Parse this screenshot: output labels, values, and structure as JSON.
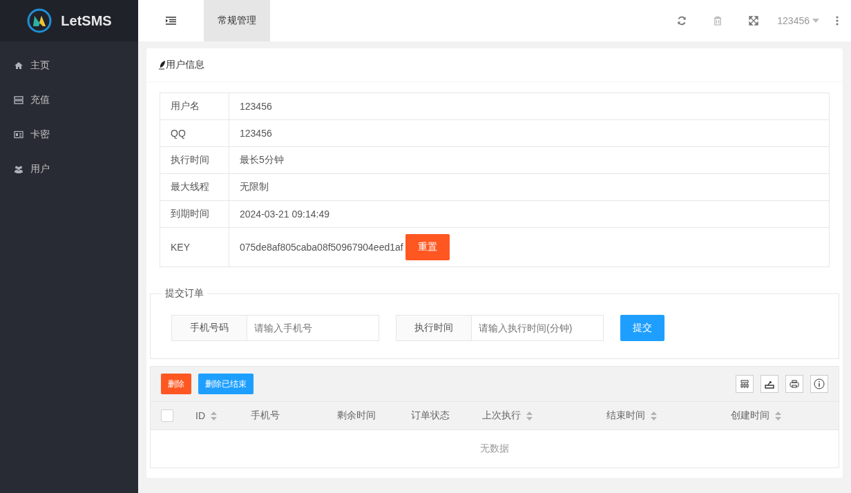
{
  "brand": {
    "name": "LetSMS"
  },
  "sidebar": {
    "items": [
      {
        "label": "主页",
        "kind": "home"
      },
      {
        "label": "充值",
        "kind": "server"
      },
      {
        "label": "卡密",
        "kind": "card"
      },
      {
        "label": "用户",
        "kind": "users"
      }
    ]
  },
  "topbar": {
    "tabs": [
      {
        "label": "常规管理",
        "selected": true
      }
    ],
    "user": "123456"
  },
  "user_info": {
    "title": "用户信息",
    "rows": [
      {
        "label": "用户名",
        "value": "123456"
      },
      {
        "label": "QQ",
        "value": "123456"
      },
      {
        "label": "执行时间",
        "value": "最长5分钟"
      },
      {
        "label": "最大线程",
        "value": "无限制"
      },
      {
        "label": "到期时间",
        "value": "2024-03-21 09:14:49"
      },
      {
        "label": "KEY",
        "value": "075de8af805caba08f50967904eed1af",
        "button": "重置"
      }
    ]
  },
  "order_form": {
    "legend": "提交订单",
    "fields": [
      {
        "label": "手机号码",
        "placeholder": "请输入手机号"
      },
      {
        "label": "执行时间",
        "placeholder": "请输入执行时间(分钟)"
      }
    ],
    "submit": "提交"
  },
  "orders": {
    "buttons": [
      {
        "label": "删除",
        "kind": "danger"
      },
      {
        "label": "删除已结束",
        "kind": "primary"
      }
    ],
    "select_all": {
      "checked": false
    },
    "columns": [
      {
        "label": "ID",
        "sortable": true
      },
      {
        "label": "手机号",
        "sortable": false
      },
      {
        "label": "剩余时间",
        "sortable": false
      },
      {
        "label": "订单状态",
        "sortable": false
      },
      {
        "label": "上次执行",
        "sortable": true
      },
      {
        "label": "结束时间",
        "sortable": true
      },
      {
        "label": "创建时间",
        "sortable": true
      }
    ],
    "empty": "无数据"
  }
}
